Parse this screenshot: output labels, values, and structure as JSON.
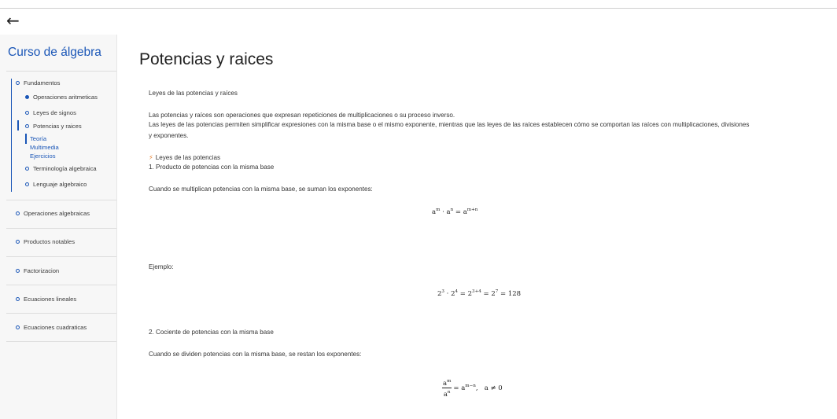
{
  "topbar": {
    "back_icon": "←"
  },
  "sidebar": {
    "title": "Curso de álgebra",
    "fundamentos": {
      "label": "Fundamentos",
      "items": [
        "Operaciones aritmeticas",
        "Leyes de signos",
        "Potencias y raices",
        "Terminología algebraica",
        "Lenguaje algebraico"
      ],
      "subitems": [
        "Teoría",
        "Multimedia",
        "Ejercicios"
      ]
    },
    "sections": [
      "Operaciones algebraicas",
      "Productos notables",
      "Factorizacion",
      "Ecuaciones lineales",
      "Ecuaciones cuadraticas"
    ]
  },
  "main": {
    "title": "Potencias y raices",
    "subtitle": "Leyes de las potencias y raíces",
    "intro1": "Las potencias y raíces son operaciones que expresan repeticiones de multiplicaciones o su proceso inverso.",
    "intro2": "Las leyes de las potencias permiten simplificar expresiones con la misma base o el mismo exponente, mientras que las leyes de las raíces establecen cómo se comportan las raíces con multiplicaciones, divisiones",
    "intro3": "y exponentes.",
    "section_icon": "⚡",
    "section_heading": "Leyes de las potencias",
    "law1_title": "1. Producto de potencias con la misma base",
    "law1_desc": "Cuando se multiplican potencias con la misma base, se suman los exponentes:",
    "law1_formula": {
      "a": "a",
      "m": "m",
      "dot": "·",
      "n": "n",
      "eq": "=",
      "mn": "m+n"
    },
    "example_label": "Ejemplo:",
    "example_formula": {
      "b1": "2",
      "e1": "3",
      "b2": "2",
      "e2": "4",
      "e3": "3+4",
      "e4": "7",
      "result": "128"
    },
    "law2_title": "2. Cociente de potencias con la misma base",
    "law2_desc": "Cuando se dividen potencias con la misma base, se restan los exponentes:",
    "law2_formula": {
      "num": "m",
      "den": "n",
      "res": "m−n",
      "cond": "a ≠ 0"
    }
  }
}
